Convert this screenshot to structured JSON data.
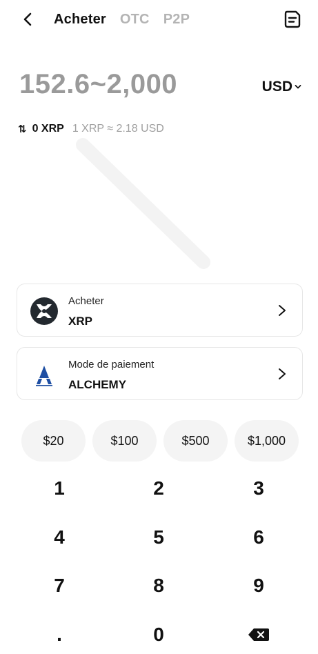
{
  "header": {
    "back_icon": "chevron-left-icon",
    "tabs": [
      {
        "label": "Acheter",
        "active": true
      },
      {
        "label": "OTC",
        "active": false
      },
      {
        "label": "P2P",
        "active": false
      }
    ],
    "orders_icon": "order-list-icon"
  },
  "amount": {
    "range": "152.6~2,000",
    "currency": "USD"
  },
  "conversion": {
    "swap_icon": "⇅",
    "quantity": "0 XRP",
    "rate": "1 XRP ≈ 2.18 USD"
  },
  "buy_card": {
    "label": "Acheter",
    "value": "XRP",
    "icon": "xrp-logo-icon"
  },
  "payment_card": {
    "label": "Mode de paiement",
    "value": "ALCHEMY",
    "icon": "alchemy-pay-logo-icon"
  },
  "presets": [
    "$20",
    "$100",
    "$500",
    "$1,000"
  ],
  "keypad": {
    "keys": [
      "1",
      "2",
      "3",
      "4",
      "5",
      "6",
      "7",
      "8",
      "9",
      ".",
      "0"
    ],
    "delete_icon": "backspace-icon"
  },
  "colors": {
    "muted": "#9a9a9a",
    "card_border": "#e6e6e6",
    "preset_bg": "#f4f4f4",
    "alchemy_blue": "#1f4fa3"
  }
}
